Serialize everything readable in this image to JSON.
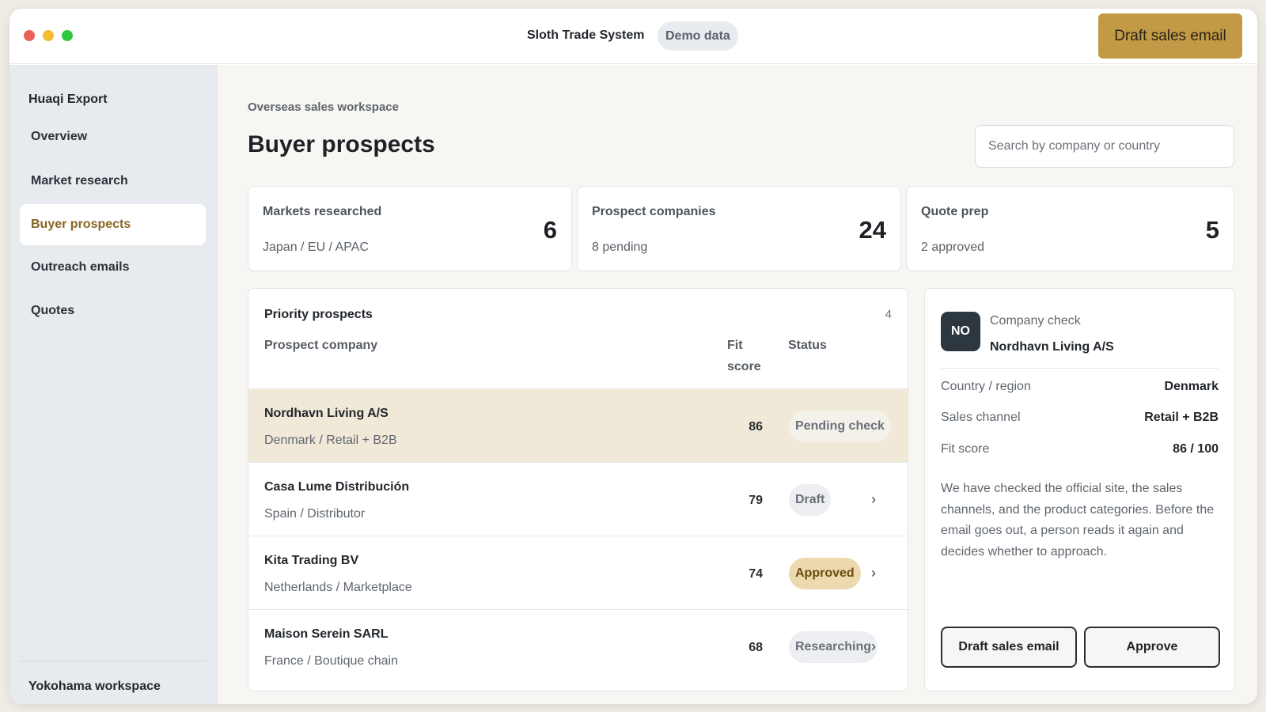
{
  "window": {
    "traffic_colors": [
      "#ec5f57",
      "#f2bd2f",
      "#2ec840"
    ]
  },
  "titlebar": {
    "app_title": "Sloth Trade System",
    "badge": "Demo data",
    "primary_action": "Draft sales email",
    "accent_color": "#c29a45"
  },
  "sidebar": {
    "org_name": "Huaqi Export",
    "items": [
      {
        "label": "Overview",
        "active": false
      },
      {
        "label": "Market research",
        "active": false
      },
      {
        "label": "Buyer prospects",
        "active": true
      },
      {
        "label": "Outreach emails",
        "active": false
      },
      {
        "label": "Quotes",
        "active": false
      }
    ],
    "workspace": "Yokohama workspace"
  },
  "header": {
    "breadcrumb": "Overseas sales workspace",
    "title": "Buyer prospects",
    "search_placeholder": "Search by company or country"
  },
  "stats": [
    {
      "label": "Markets researched",
      "sub": "Japan / EU / APAC",
      "value": "6"
    },
    {
      "label": "Prospect companies",
      "sub": "8 pending",
      "value": "24"
    },
    {
      "label": "Quote prep",
      "sub": "2 approved",
      "value": "5"
    }
  ],
  "table": {
    "title": "Priority prospects",
    "count": "4",
    "columns": {
      "company": "Prospect company",
      "fit_line1": "Fit",
      "fit_line2": "score",
      "status": "Status"
    },
    "rows": [
      {
        "name": "Nordhavn Living A/S",
        "sub": "Denmark / Retail + B2B",
        "score": "86",
        "status": "Pending check",
        "status_kind": "pending",
        "chevron": "",
        "selected": true
      },
      {
        "name": "Casa Lume Distribución",
        "sub": "Spain / Distributor",
        "score": "79",
        "status": "Draft",
        "status_kind": "draft",
        "chevron": "›",
        "selected": false
      },
      {
        "name": "Kita Trading BV",
        "sub": "Netherlands / Marketplace",
        "score": "74",
        "status": "Approved",
        "status_kind": "approved",
        "chevron": "›",
        "selected": false
      },
      {
        "name": "Maison Serein SARL",
        "sub": "France / Boutique chain",
        "score": "68",
        "status": "Researching",
        "status_kind": "research",
        "chevron": "›",
        "selected": false
      }
    ]
  },
  "detail": {
    "avatar": "NO",
    "kicker": "Company check",
    "company": "Nordhavn Living A/S",
    "fields": [
      {
        "label": "Country / region",
        "value": "Denmark"
      },
      {
        "label": "Sales channel",
        "value": "Retail + B2B"
      },
      {
        "label": "Fit score",
        "value": "86 / 100"
      }
    ],
    "note": "We have checked the official site, the sales channels, and the product categories. Before the email goes out, a person reads it again and decides whether to approach.",
    "buttons": {
      "draft": "Draft sales email",
      "approve": "Approve"
    }
  }
}
